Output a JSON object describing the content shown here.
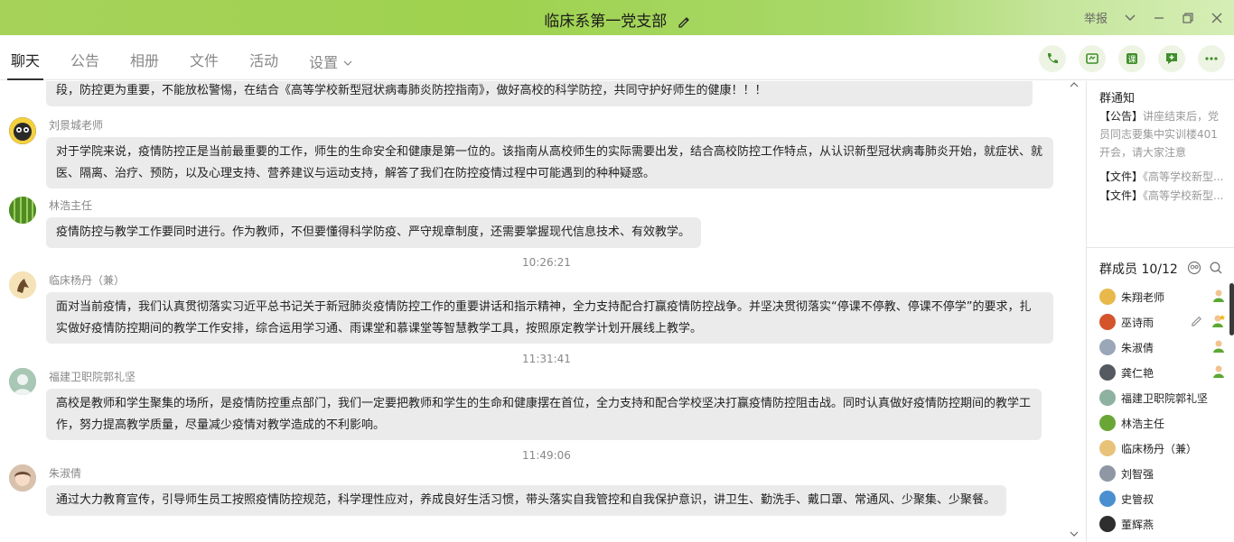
{
  "window": {
    "title": "临床系第一党支部",
    "report_label": "举报"
  },
  "tabs": [
    {
      "label": "聊天",
      "active": true
    },
    {
      "label": "公告",
      "active": false
    },
    {
      "label": "相册",
      "active": false
    },
    {
      "label": "文件",
      "active": false
    },
    {
      "label": "活动",
      "active": false
    },
    {
      "label": "设置",
      "active": false
    }
  ],
  "tab_icons": [
    "phone-icon",
    "video-call-icon",
    "course-icon",
    "add-note-icon",
    "more-icon"
  ],
  "messages": [
    {
      "text": "段，防控更为重要，不能放松警惕，在结合《高等学校新型冠状病毒肺炎防控指南》，做好高校的科学防控，共同守护好师生的健康！！！"
    },
    {
      "sender": "刘景城老师",
      "lines": [
        "对于学院来说，疫情防控正是当前最重要的工作，师生的生命安全和健康是第一位的。该指南从高校师生的实际需要出发，结合高校防控工作特点，从认识新型冠状病毒肺炎开始，就症状、就",
        "医、隔离、治疗、预防，以及心理支持、营养建议与运动支持，解答了我们在防控疫情过程中可能遇到的种种疑惑。"
      ]
    },
    {
      "sender": "林浩主任",
      "lines": [
        "疫情防控与教学工作要同时进行。作为教师，不但要懂得科学防疫、严守规章制度，还需要掌握现代信息技术、有效教学。"
      ]
    },
    {
      "time": "10:26:21"
    },
    {
      "sender": "临床杨丹（兼）",
      "lines": [
        "面对当前疫情，我们认真贯彻落实习近平总书记关于新冠肺炎疫情防控工作的重要讲话和指示精神，全力支持配合打赢疫情防控战争。并坚决贯彻落实“停课不停教、停课不停学”的要求，扎",
        "实做好疫情防控期间的教学工作安排，综合运用学习通、雨课堂和慕课堂等智慧教学工具，按照原定教学计划开展线上教学。"
      ]
    },
    {
      "time": "11:31:41"
    },
    {
      "sender": "福建卫职院郭礼坚",
      "lines": [
        "高校是教师和学生聚集的场所，是疫情防控重点部门，我们一定要把教师和学生的生命和健康摆在首位，全力支持和配合学校坚决打赢疫情防控阻击战。同时认真做好疫情防控期间的教学工",
        "作，努力提高教学质量，尽量减少疫情对教学造成的不利影响。"
      ]
    },
    {
      "time": "11:49:06"
    },
    {
      "sender": "朱淑倩",
      "lines": [
        "通过大力教育宣传，引导师生员工按照疫情防控规范，科学理性应对，养成良好生活习惯，带头落实自我管控和自我保护意识，讲卫生、勤洗手、戴口罩、常通风、少聚集、少聚餐。"
      ]
    }
  ],
  "notice": {
    "title": "群通知",
    "items": [
      {
        "tag": "【公告】",
        "text": "讲座结束后，党员同志要集中实训楼401开会，请大家注意"
      },
      {
        "tag": "【文件】",
        "text": "《高等学校新型..."
      },
      {
        "tag": "【文件】",
        "text": "《高等学校新型..."
      }
    ]
  },
  "members": {
    "title": "群成员 10/12",
    "list": [
      {
        "name": "朱翔老师",
        "color": "#e8b84a",
        "badge": "admin"
      },
      {
        "name": "巫诗雨",
        "color": "#d4552c",
        "badge": "owner"
      },
      {
        "name": "朱淑倩",
        "color": "#9aa7b8",
        "badge": "admin"
      },
      {
        "name": "龚仁艳",
        "color": "#555a60",
        "badge": "admin"
      },
      {
        "name": "福建卫职院郭礼坚",
        "color": "#8fb1a0",
        "badge": ""
      },
      {
        "name": "林浩主任",
        "color": "#6aa636",
        "badge": ""
      },
      {
        "name": "临床杨丹（兼）",
        "color": "#e9c27a",
        "badge": ""
      },
      {
        "name": "刘智强",
        "color": "#8e97a3",
        "badge": ""
      },
      {
        "name": "史管叔",
        "color": "#4a8fd0",
        "badge": ""
      },
      {
        "name": "董辉燕",
        "color": "#2e2e2e",
        "badge": ""
      }
    ]
  },
  "colors": {
    "titlebar": "#a6d25a",
    "accent": "#6aa636",
    "bubble": "#ebebeb"
  }
}
